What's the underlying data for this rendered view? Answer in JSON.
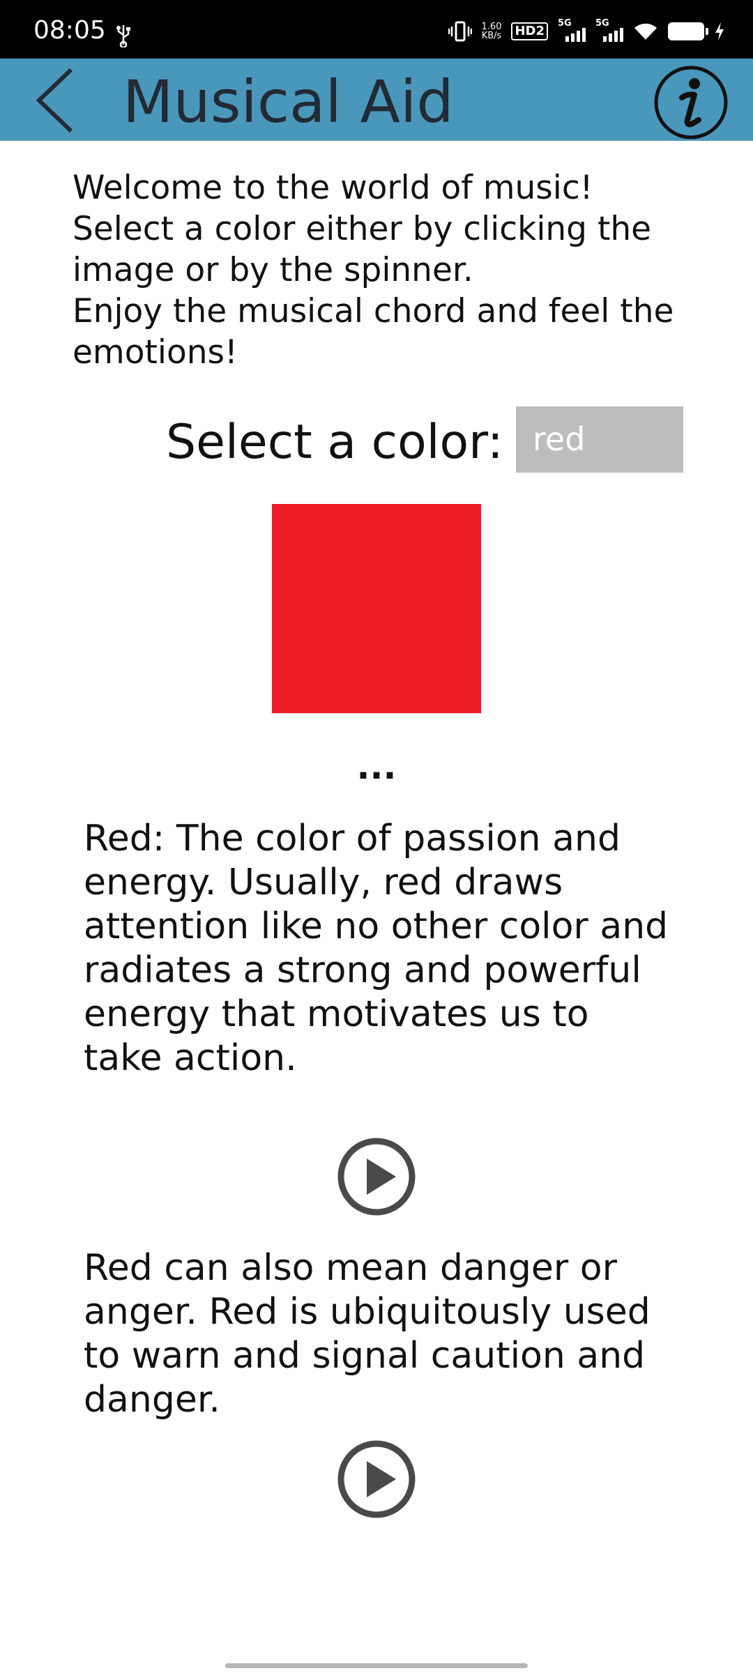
{
  "status_bar": {
    "time": "08:05",
    "net_speed_value": "1.60",
    "net_speed_unit": "KB/s",
    "hd_badge": "HD2",
    "signal_1_label": "5G",
    "signal_2_label": "5G",
    "icons": [
      "usb-icon",
      "vibrate-icon",
      "signal-icon",
      "wifi-icon",
      "battery-icon",
      "charging-icon"
    ]
  },
  "app_bar": {
    "title": "Musical Aid",
    "background": "#4a97bc",
    "back_icon": "chevron-left-icon",
    "info_icon": "info-icon"
  },
  "main": {
    "intro": "Welcome to the world of music!\nSelect a color either by clicking the image or by the spinner.\nEnjoy the musical chord and feel the emotions!",
    "select_label": "Select a color:",
    "spinner_value": "red",
    "swatch_color": "#ee1c25",
    "ellipsis": "...",
    "description_1": "Red: The color of passion and energy. Usually, red draws attention like no other color and radiates a strong and powerful energy that motivates us to take action.",
    "description_2": "Red can also mean danger or anger. Red is ubiquitously used to warn and signal caution and danger.",
    "play_icon": "play-circle-icon"
  }
}
